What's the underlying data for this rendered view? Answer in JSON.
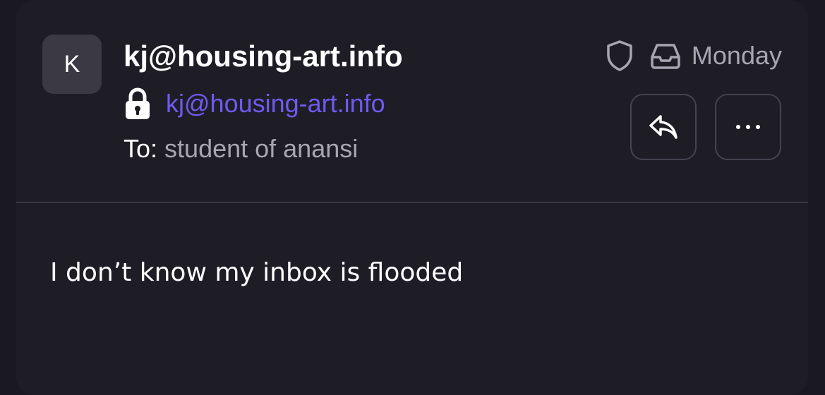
{
  "email": {
    "avatar_initial": "K",
    "sender_name": "kj@housing-art.info",
    "sender_address": "kj@housing-art.info",
    "to_label": "To:",
    "to_value": "student of anansi",
    "date": "Monday",
    "body": "I don’t know my inbox is flooded"
  },
  "icons": {
    "lock": "lock-icon",
    "shield": "shield-icon",
    "inbox": "inbox-icon",
    "reply": "reply-icon",
    "more": "more-icon"
  },
  "colors": {
    "background": "#1e1d26",
    "accent": "#6f5af0",
    "muted_text": "#a8a6b2"
  }
}
